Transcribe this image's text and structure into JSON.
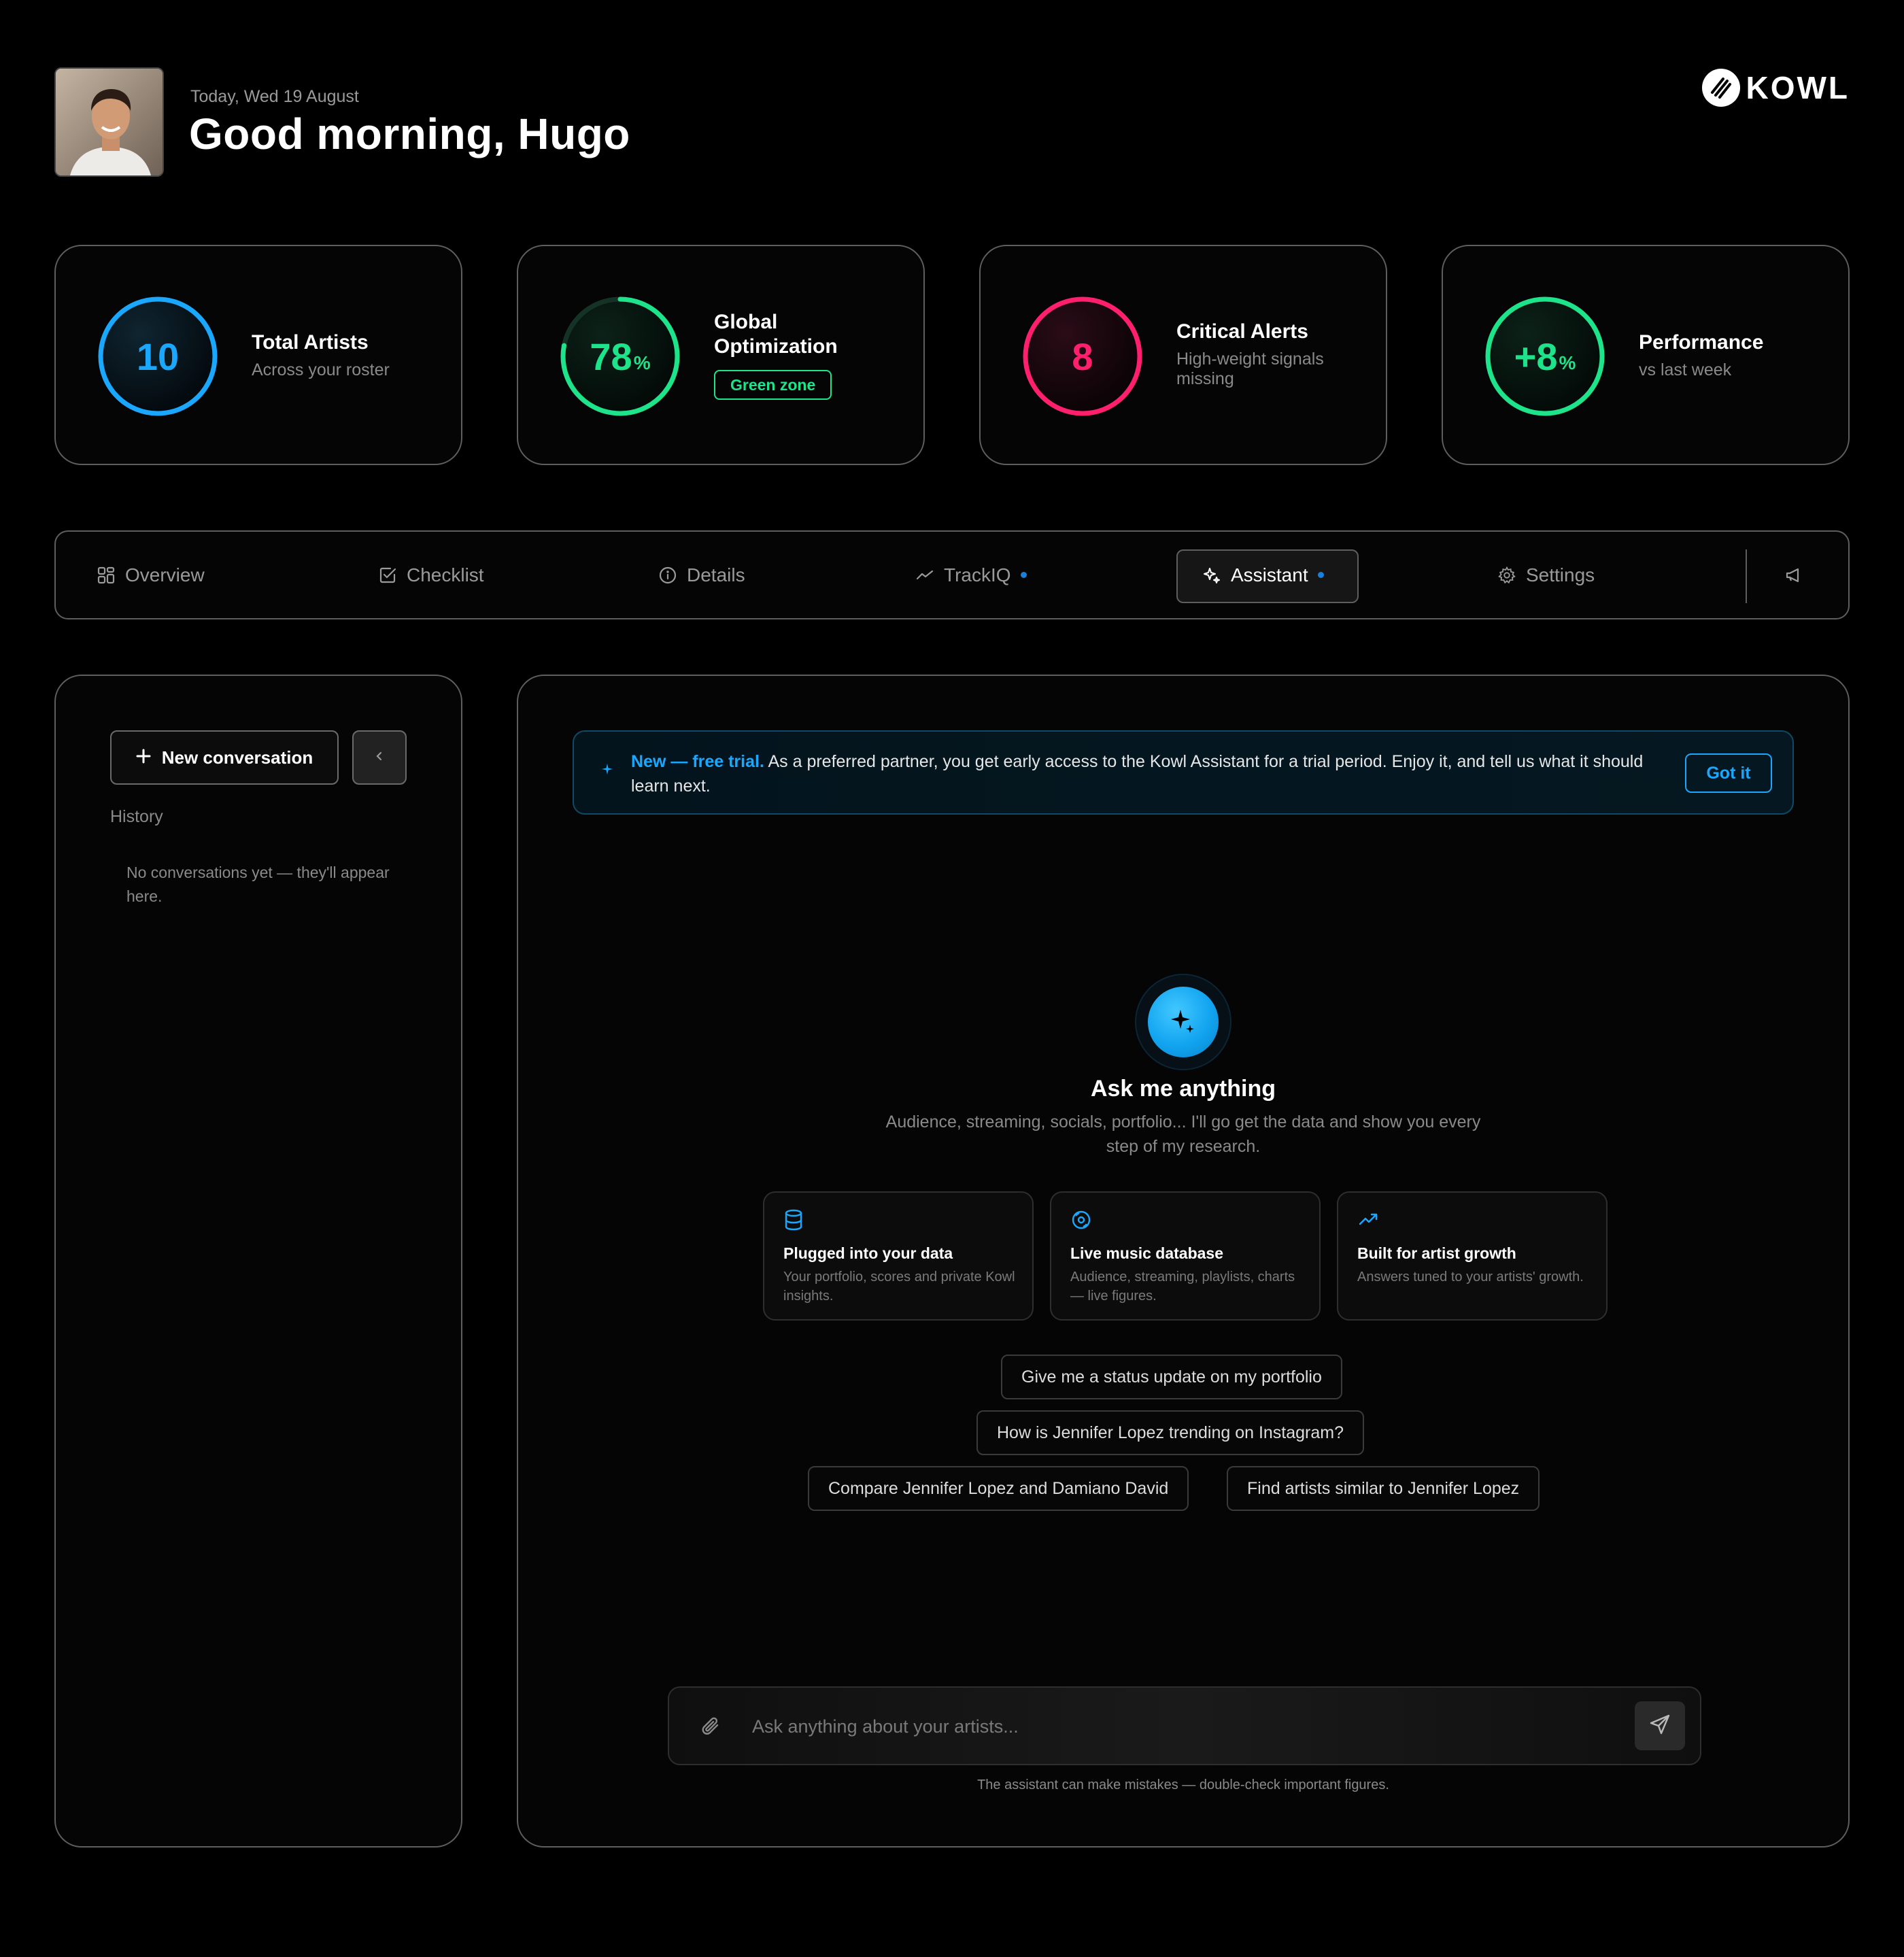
{
  "header": {
    "date": "Today, Wed 19 August",
    "greeting": "Good morning, Hugo",
    "brand": "KOWL"
  },
  "stats": [
    {
      "value": "10",
      "unit": "",
      "title": "Total Artists",
      "subtitle": "Across your roster",
      "color": "#1aa8ff",
      "progress": 1.0
    },
    {
      "value": "78",
      "unit": "%",
      "title": "Global Optimization",
      "badge": "Green zone",
      "color": "#1de38a",
      "progress": 0.78
    },
    {
      "value": "8",
      "unit": "",
      "title": "Critical Alerts",
      "subtitle": "High-weight signals missing",
      "color": "#ff1f6d",
      "progress": 1.0
    },
    {
      "value": "+8",
      "unit": "%",
      "title": "Performance",
      "subtitle": "vs last week",
      "color": "#1de38a",
      "progress": 1.0
    }
  ],
  "nav": {
    "items": [
      {
        "label": "Overview",
        "icon": "grid-icon"
      },
      {
        "label": "Checklist",
        "icon": "checkbox-icon"
      },
      {
        "label": "Details",
        "icon": "info-icon"
      },
      {
        "label": "TrackIQ",
        "icon": "trend-icon",
        "dot": true
      },
      {
        "label": "Assistant",
        "icon": "sparkle-icon",
        "dot": true,
        "active": true
      },
      {
        "label": "Settings",
        "icon": "gear-icon"
      }
    ],
    "extra_icon": "megaphone-icon"
  },
  "sidebar": {
    "new_conversation": "New conversation",
    "history_label": "History",
    "empty_text": "No conversations yet — they'll appear here."
  },
  "banner": {
    "highlight": "New — free trial.",
    "text": " As a preferred partner, you get early access to the Kowl Assistant for a trial period. Enjoy it, and tell us what it should learn next.",
    "button": "Got it"
  },
  "assistant": {
    "title": "Ask me anything",
    "subtitle": "Audience, streaming, socials, portfolio... I'll go get the data and show you every step of my research.",
    "features": [
      {
        "icon": "database-icon",
        "title": "Plugged into your data",
        "desc": "Your portfolio, scores and private Kowl insights."
      },
      {
        "icon": "vinyl-icon",
        "title": "Live music database",
        "desc": "Audience, streaming, playlists, charts — live figures."
      },
      {
        "icon": "growth-icon",
        "title": "Built for artist growth",
        "desc": "Answers tuned to your artists' growth."
      }
    ],
    "suggestions": [
      "Give me a status update on my portfolio",
      "How is Jennifer Lopez trending on Instagram?",
      "Compare Jennifer Lopez and Damiano David",
      "Find artists similar to Jennifer Lopez"
    ],
    "input_placeholder": "Ask anything about your artists...",
    "input_value": "",
    "disclaimer": "The assistant can make mistakes — double-check important figures."
  },
  "colors": {
    "accent": "#1aa8ff",
    "success": "#1de38a",
    "danger": "#ff1f6d"
  }
}
